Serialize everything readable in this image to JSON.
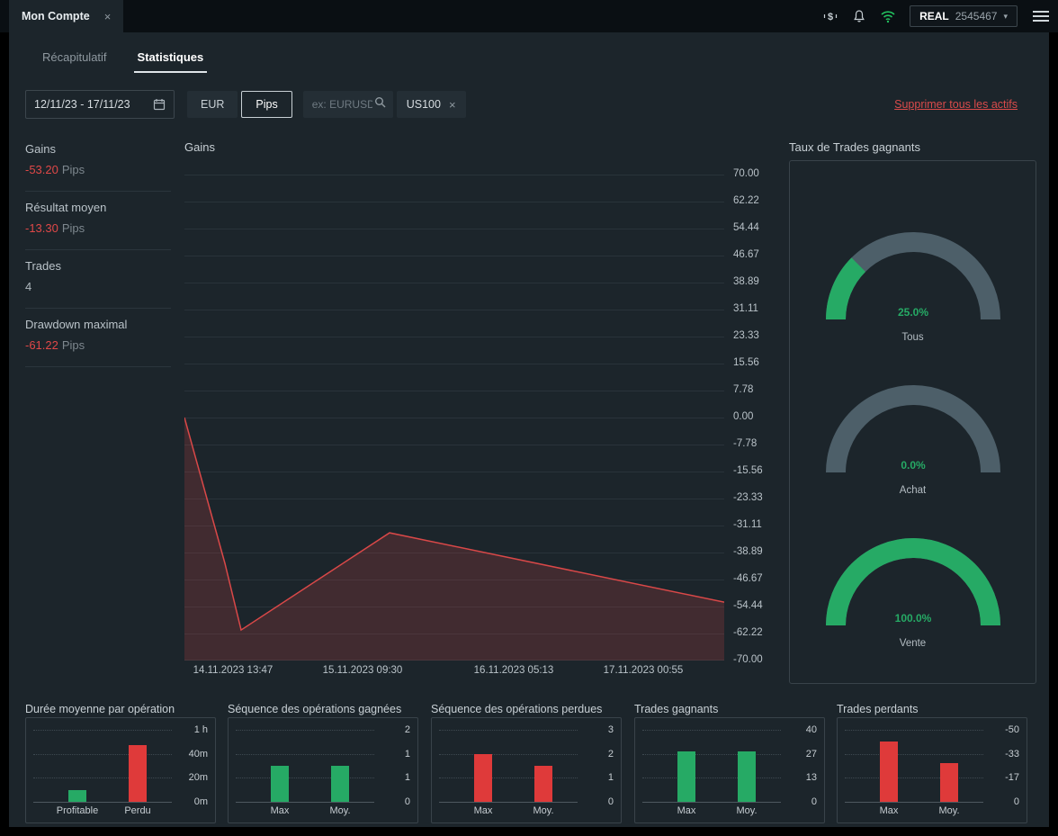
{
  "topbar": {
    "tab_title": "Mon Compte",
    "close": "×",
    "account_type": "REAL",
    "account_number": "2545467",
    "caret": "▾"
  },
  "tabs": {
    "summary": "Récapitulatif",
    "statistics": "Statistiques"
  },
  "filters": {
    "date_range": "12/11/23 - 17/11/23",
    "currency_button": "EUR",
    "pips_button": "Pips",
    "search_placeholder": "ex: EURUSD",
    "asset_chip": "US100",
    "chip_close": "×",
    "remove_all_link": "Supprimer tous les actifs"
  },
  "summary_stats": [
    {
      "label": "Gains",
      "value": "-53.20",
      "unit": "Pips",
      "value_color": "red"
    },
    {
      "label": "Résultat moyen",
      "value": "-13.30",
      "unit": "Pips",
      "value_color": "red"
    },
    {
      "label": "Trades",
      "value": "4",
      "unit": "",
      "value_color": "plain"
    },
    {
      "label": "Drawdown maximal",
      "value": "-61.22",
      "unit": "Pips",
      "value_color": "red"
    }
  ],
  "colors": {
    "red": "#df3a3a",
    "green": "#26aa65",
    "gauge_track": "#4d5f69",
    "line": "#d94848",
    "area_fill": "rgba(217,72,72,0.20)"
  },
  "chart_data": [
    {
      "type": "area",
      "title": "Gains",
      "x_fractions": [
        0,
        0.075,
        0.105,
        0.38,
        1
      ],
      "values": [
        0,
        -42,
        -61.22,
        -33.22,
        -53.2
      ],
      "ylim": [
        -70,
        70
      ],
      "y_tick_labels": [
        "70.00",
        "62.22",
        "54.44",
        "46.67",
        "38.89",
        "31.11",
        "23.33",
        "15.56",
        "7.78",
        "0.00",
        "-7.78",
        "-15.56",
        "-23.33",
        "-31.11",
        "-38.89",
        "-46.67",
        "-54.44",
        "-62.22",
        "-70.00"
      ],
      "x_tick_labels": [
        "14.11.2023 13:47",
        "15.11.2023 09:30",
        "16.11.2023 05:13",
        "17.11.2023 00:55"
      ],
      "x_tick_fractions": [
        0.09,
        0.33,
        0.61,
        0.85
      ],
      "grid": "horizontal"
    },
    {
      "type": "gauge",
      "title": "Taux de Trades gagnants",
      "gauges": [
        {
          "label": "Tous",
          "value": 25.0,
          "display": "25.0%"
        },
        {
          "label": "Achat",
          "value": 0.0,
          "display": "0.0%"
        },
        {
          "label": "Vente",
          "value": 100.0,
          "display": "100.0%"
        }
      ]
    },
    {
      "type": "bar",
      "title": "Durée moyenne par opération",
      "categories": [
        "Profitable",
        "Perdu"
      ],
      "values": [
        10,
        47
      ],
      "bar_colors": [
        "green",
        "red"
      ],
      "y_tick_labels": [
        "1 h",
        "40m",
        "20m",
        "0m"
      ],
      "ymax": 60
    },
    {
      "type": "bar",
      "title": "Séquence des opérations gagnées",
      "categories": [
        "Max",
        "Moy."
      ],
      "values": [
        1,
        1
      ],
      "bar_colors": [
        "green",
        "green"
      ],
      "y_tick_labels": [
        "2",
        "1",
        "1",
        "0"
      ],
      "ymax": 2
    },
    {
      "type": "bar",
      "title": "Séquence des opérations perdues",
      "categories": [
        "Max",
        "Moy."
      ],
      "values": [
        2,
        1.5
      ],
      "bar_colors": [
        "red",
        "red"
      ],
      "y_tick_labels": [
        "3",
        "2",
        "1",
        "0"
      ],
      "ymax": 3
    },
    {
      "type": "bar",
      "title": "Trades gagnants",
      "categories": [
        "Max",
        "Moy."
      ],
      "values": [
        28,
        28
      ],
      "bar_colors": [
        "green",
        "green"
      ],
      "y_tick_labels": [
        "40",
        "27",
        "13",
        "0"
      ],
      "ymax": 40
    },
    {
      "type": "bar",
      "title": "Trades perdants",
      "categories": [
        "Max",
        "Moy."
      ],
      "values": [
        42,
        27
      ],
      "bar_colors": [
        "red",
        "red"
      ],
      "y_tick_labels": [
        "-50",
        "-33",
        "-17",
        "0"
      ],
      "ymax": 50
    }
  ]
}
